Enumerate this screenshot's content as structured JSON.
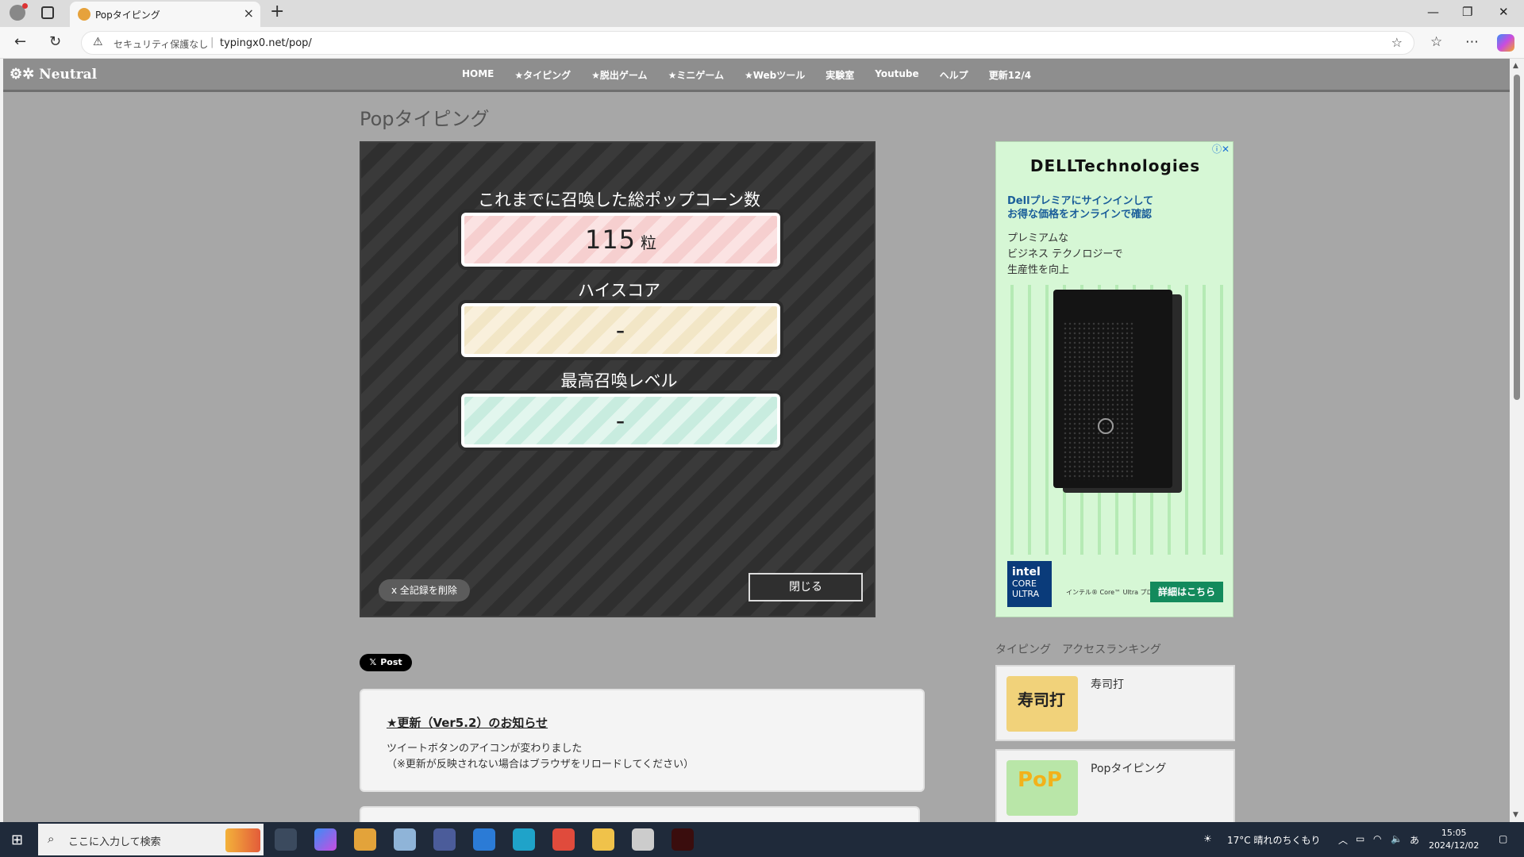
{
  "browser": {
    "tab_title": "Popタイピング",
    "security": "セキュリティ保護なし",
    "url": "typingx0.net/pop/"
  },
  "site": {
    "logo": "Neutral",
    "menu": [
      "HOME",
      "★タイピング",
      "★脱出ゲーム",
      "★ミニゲーム",
      "★Webツール",
      "実験室",
      "Youtube",
      "ヘルプ",
      "更新12/4"
    ]
  },
  "page_title": "Popタイピング",
  "game": {
    "label1": "これまでに召喚した総ポップコーン数",
    "value1": "115",
    "unit1": "粒",
    "label2": "ハイスコア",
    "value2": "-",
    "label3": "最高召喚レベル",
    "value3": "-",
    "delete_btn": "x 全記録を削除",
    "close_btn": "閉じる"
  },
  "xpost": "Post",
  "notice": {
    "heading": "★更新（Ver5.2）のお知らせ",
    "line1": "ツイートボタンのアイコンが変わりました",
    "line2": "（※更新が反映されない場合はブラウザをリロードしてください）"
  },
  "ad": {
    "brand": "DELLTechnologies",
    "headline1": "Dellプレミアにサインインして",
    "headline2": "お得な価格をオンラインで確認",
    "body1": "プレミアムな",
    "body2": "ビジネス テクノロジーで",
    "body3": "生産性を向上",
    "intel1": "intel",
    "intel2": "CORE",
    "intel3": "ULTRA",
    "small": "インテル® Core™ Ultra プロセッサーで AI を加速",
    "cta": "詳細はこちら"
  },
  "ranking": {
    "title": "タイピング　アクセスランキング",
    "items": [
      "寿司打",
      "Popタイピング"
    ]
  },
  "taskbar": {
    "search_placeholder": "ここに入力して検索",
    "weather": "17°C  晴れのちくもり",
    "ime": "あ",
    "time": "15:05",
    "date": "2024/12/02"
  }
}
